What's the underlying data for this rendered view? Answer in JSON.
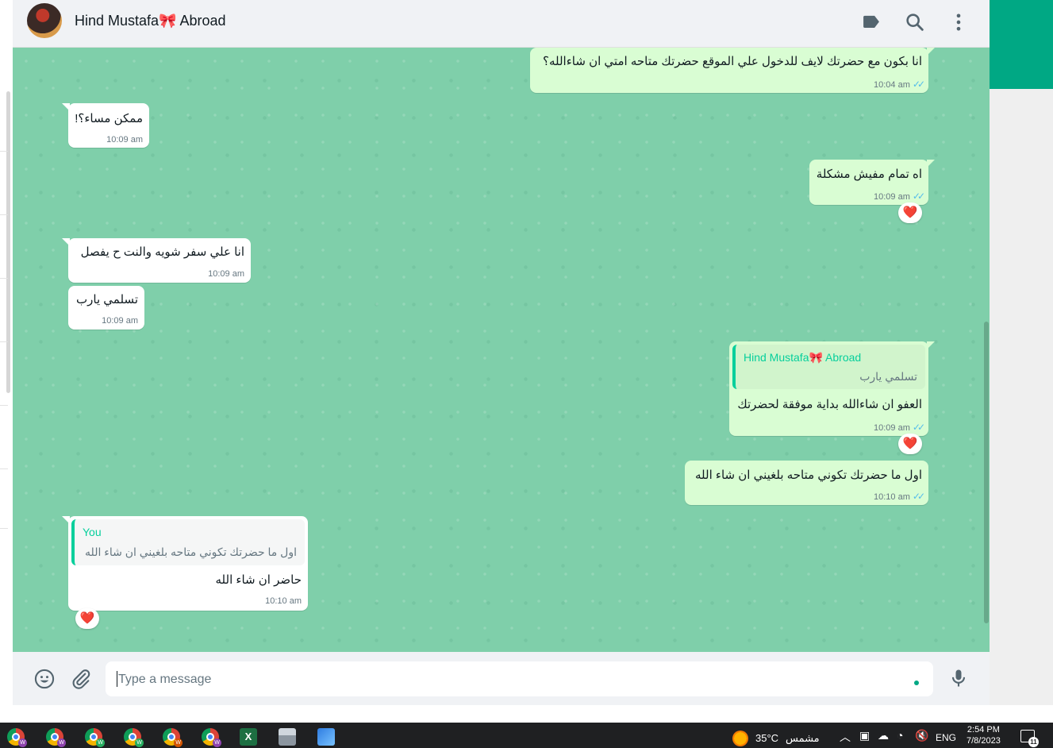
{
  "header": {
    "contact_name": "Hind Mustafa🎀 Abroad",
    "icons": [
      "label-icon",
      "search-icon",
      "more-options-icon"
    ]
  },
  "messages": [
    {
      "dir": "out",
      "text": "انا بكون مع حضرتك لايف للدخول علي الموقع حضرتك متاحه امتي ان شاءالله؟",
      "time": "10:04 am",
      "status": "read"
    },
    {
      "dir": "in",
      "text": "ممكن مساء؟!",
      "time": "10:09 am"
    },
    {
      "dir": "out",
      "text": "اه تمام مفيش مشكلة",
      "time": "10:09 am",
      "status": "read",
      "reaction": "❤️"
    },
    {
      "dir": "in",
      "text": "انا علي سفر شويه والنت ح يفصل",
      "time": "10:09 am"
    },
    {
      "dir": "in",
      "text": "تسلمي يارب",
      "time": "10:09 am"
    },
    {
      "dir": "out",
      "quote_name": "Hind Mustafa🎀 Abroad",
      "quote_text": "تسلمي يارب",
      "text": "العفو ان شاءالله بداية موفقة لحضرتك",
      "time": "10:09 am",
      "status": "read",
      "reaction": "❤️"
    },
    {
      "dir": "out",
      "text": "اول ما حضرتك تكوني متاحه بلغيني ان شاء الله",
      "time": "10:10 am",
      "status": "read"
    },
    {
      "dir": "in",
      "quote_name": "You",
      "quote_text": "اول ما حضرتك تكوني متاحه بلغيني ان شاء الله",
      "text": "حاضر ان شاء الله",
      "time": "10:10 am",
      "reaction": "❤️"
    }
  ],
  "composer": {
    "placeholder": "Type a message",
    "icons": [
      "emoji-icon",
      "attach-icon",
      "microphone-icon"
    ]
  },
  "taskbar": {
    "apps": [
      "chrome",
      "chrome",
      "chrome",
      "chrome",
      "chrome",
      "chrome",
      "excel",
      "printer",
      "photos"
    ],
    "weather_temp": "35°C",
    "weather_text": "مشمس",
    "language": "ENG",
    "time": "2:54 PM",
    "date": "7/8/2023",
    "notification_count": "11"
  },
  "colors": {
    "chat_bg": "#7fcfaa",
    "outgoing_bubble": "#d9fdd3",
    "incoming_bubble": "#ffffff",
    "accent": "#00a884",
    "read_ticks": "#53bdeb",
    "reaction_heart": "#e0245e"
  }
}
